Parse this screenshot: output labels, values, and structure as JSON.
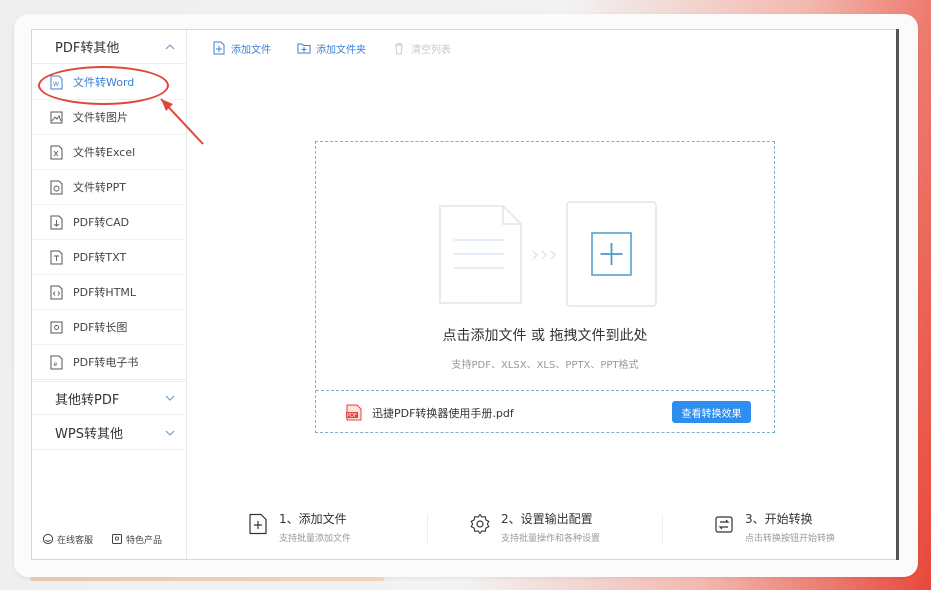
{
  "sidebar": {
    "groups": [
      {
        "label": "PDF转其他",
        "expanded": true
      },
      {
        "label": "其他转PDF",
        "expanded": false
      },
      {
        "label": "WPS转其他",
        "expanded": false
      }
    ],
    "items": [
      {
        "label": "文件转Word",
        "icon": "word-file-icon",
        "active": true
      },
      {
        "label": "文件转图片",
        "icon": "image-icon",
        "active": false
      },
      {
        "label": "文件转Excel",
        "icon": "excel-file-icon",
        "active": false
      },
      {
        "label": "文件转PPT",
        "icon": "ppt-file-icon",
        "active": false
      },
      {
        "label": "PDF转CAD",
        "icon": "cad-file-icon",
        "active": false
      },
      {
        "label": "PDF转TXT",
        "icon": "txt-file-icon",
        "active": false
      },
      {
        "label": "PDF转HTML",
        "icon": "html-file-icon",
        "active": false
      },
      {
        "label": "PDF转长图",
        "icon": "long-image-icon",
        "active": false
      },
      {
        "label": "PDF转电子书",
        "icon": "ebook-icon",
        "active": false
      }
    ],
    "footer": {
      "support_label": "在线客服",
      "products_label": "特色产品"
    }
  },
  "toolbar": {
    "add_file_label": "添加文件",
    "add_folder_label": "添加文件夹",
    "clear_list_label": "清空列表"
  },
  "dropzone": {
    "title": "点击添加文件 或 拖拽文件到此处",
    "subtitle": "支持PDF、XLSX、XLS、PPTX、PPT格式",
    "sample_file_name": "迅捷PDF转换器使用手册.pdf",
    "view_button_label": "查看转换效果"
  },
  "steps": [
    {
      "title": "1、添加文件",
      "subtitle": "支持批量添加文件",
      "icon": "add-file-icon"
    },
    {
      "title": "2、设置输出配置",
      "subtitle": "支持批量操作和各种设置",
      "icon": "gear-icon"
    },
    {
      "title": "3、开始转换",
      "subtitle": "点击转换按钮开始转换",
      "icon": "convert-icon"
    }
  ],
  "colors": {
    "accent": "#3c7fd6",
    "button": "#2d8ef0",
    "annotation": "#e0453a",
    "dashed_border": "#7fb0c8"
  }
}
